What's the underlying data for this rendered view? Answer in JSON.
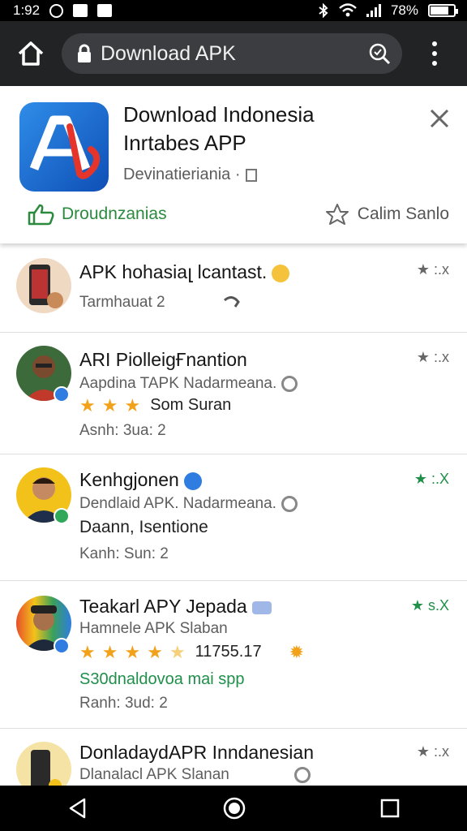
{
  "status_bar": {
    "time": "1:92",
    "battery": "78%",
    "battery_level": 0.78
  },
  "browser": {
    "url_text": "Download APK",
    "home_icon": "home-icon",
    "lock_icon": "lock-icon",
    "search_icon": "search-icon",
    "menu_icon": "more-vert-icon"
  },
  "app_banner": {
    "title": "Download Indonesia Inrtabes APP",
    "developer": "Devinatieriania ·",
    "rate_label": "Droudnzanias",
    "save_label": "Calim Sanlo",
    "brand_color": "#1a6fd8"
  },
  "list": [
    {
      "title": "APK hohasiaլ lcantast.",
      "line1": "Tarmhauat 2",
      "rating": "★ :.x",
      "rating_color": "#666666"
    },
    {
      "title": "ARI PiolleigҒnantion",
      "line1": "Aapdina TAPK Nadarmeana.",
      "stars": 3,
      "stars_text": "Som Suran",
      "line2": "Asnh: 3ua: 2",
      "rating": "★ :.x",
      "rating_color": "#666666"
    },
    {
      "title": "Kenhgjonen",
      "line1": "Dendlaid APK. Nadarmeana.",
      "line2": "Daann, Isentione",
      "line3": "Kanh: Sun: 2",
      "rating": "★ :.X",
      "rating_color": "#1f8f4a"
    },
    {
      "title": "Teakarl APY Jepada",
      "line1": "Hamnele APK Slaban",
      "stars": 4.5,
      "stars_text": "11755.17",
      "line2": "S30dnaldovoa mai spp",
      "line3": "Ranh: 3ud: 2",
      "rating": "★ s.X",
      "rating_color": "#1f8f4a"
    },
    {
      "title": "DonladaydAPR Inndanesian",
      "line1": "Dlanalacl APK Slanan",
      "rating": "★ :.x",
      "rating_color": "#666666"
    }
  ],
  "nav_bar": {
    "back_icon": "back-icon",
    "home_icon": "home-circle-icon",
    "recents_icon": "recents-icon"
  }
}
